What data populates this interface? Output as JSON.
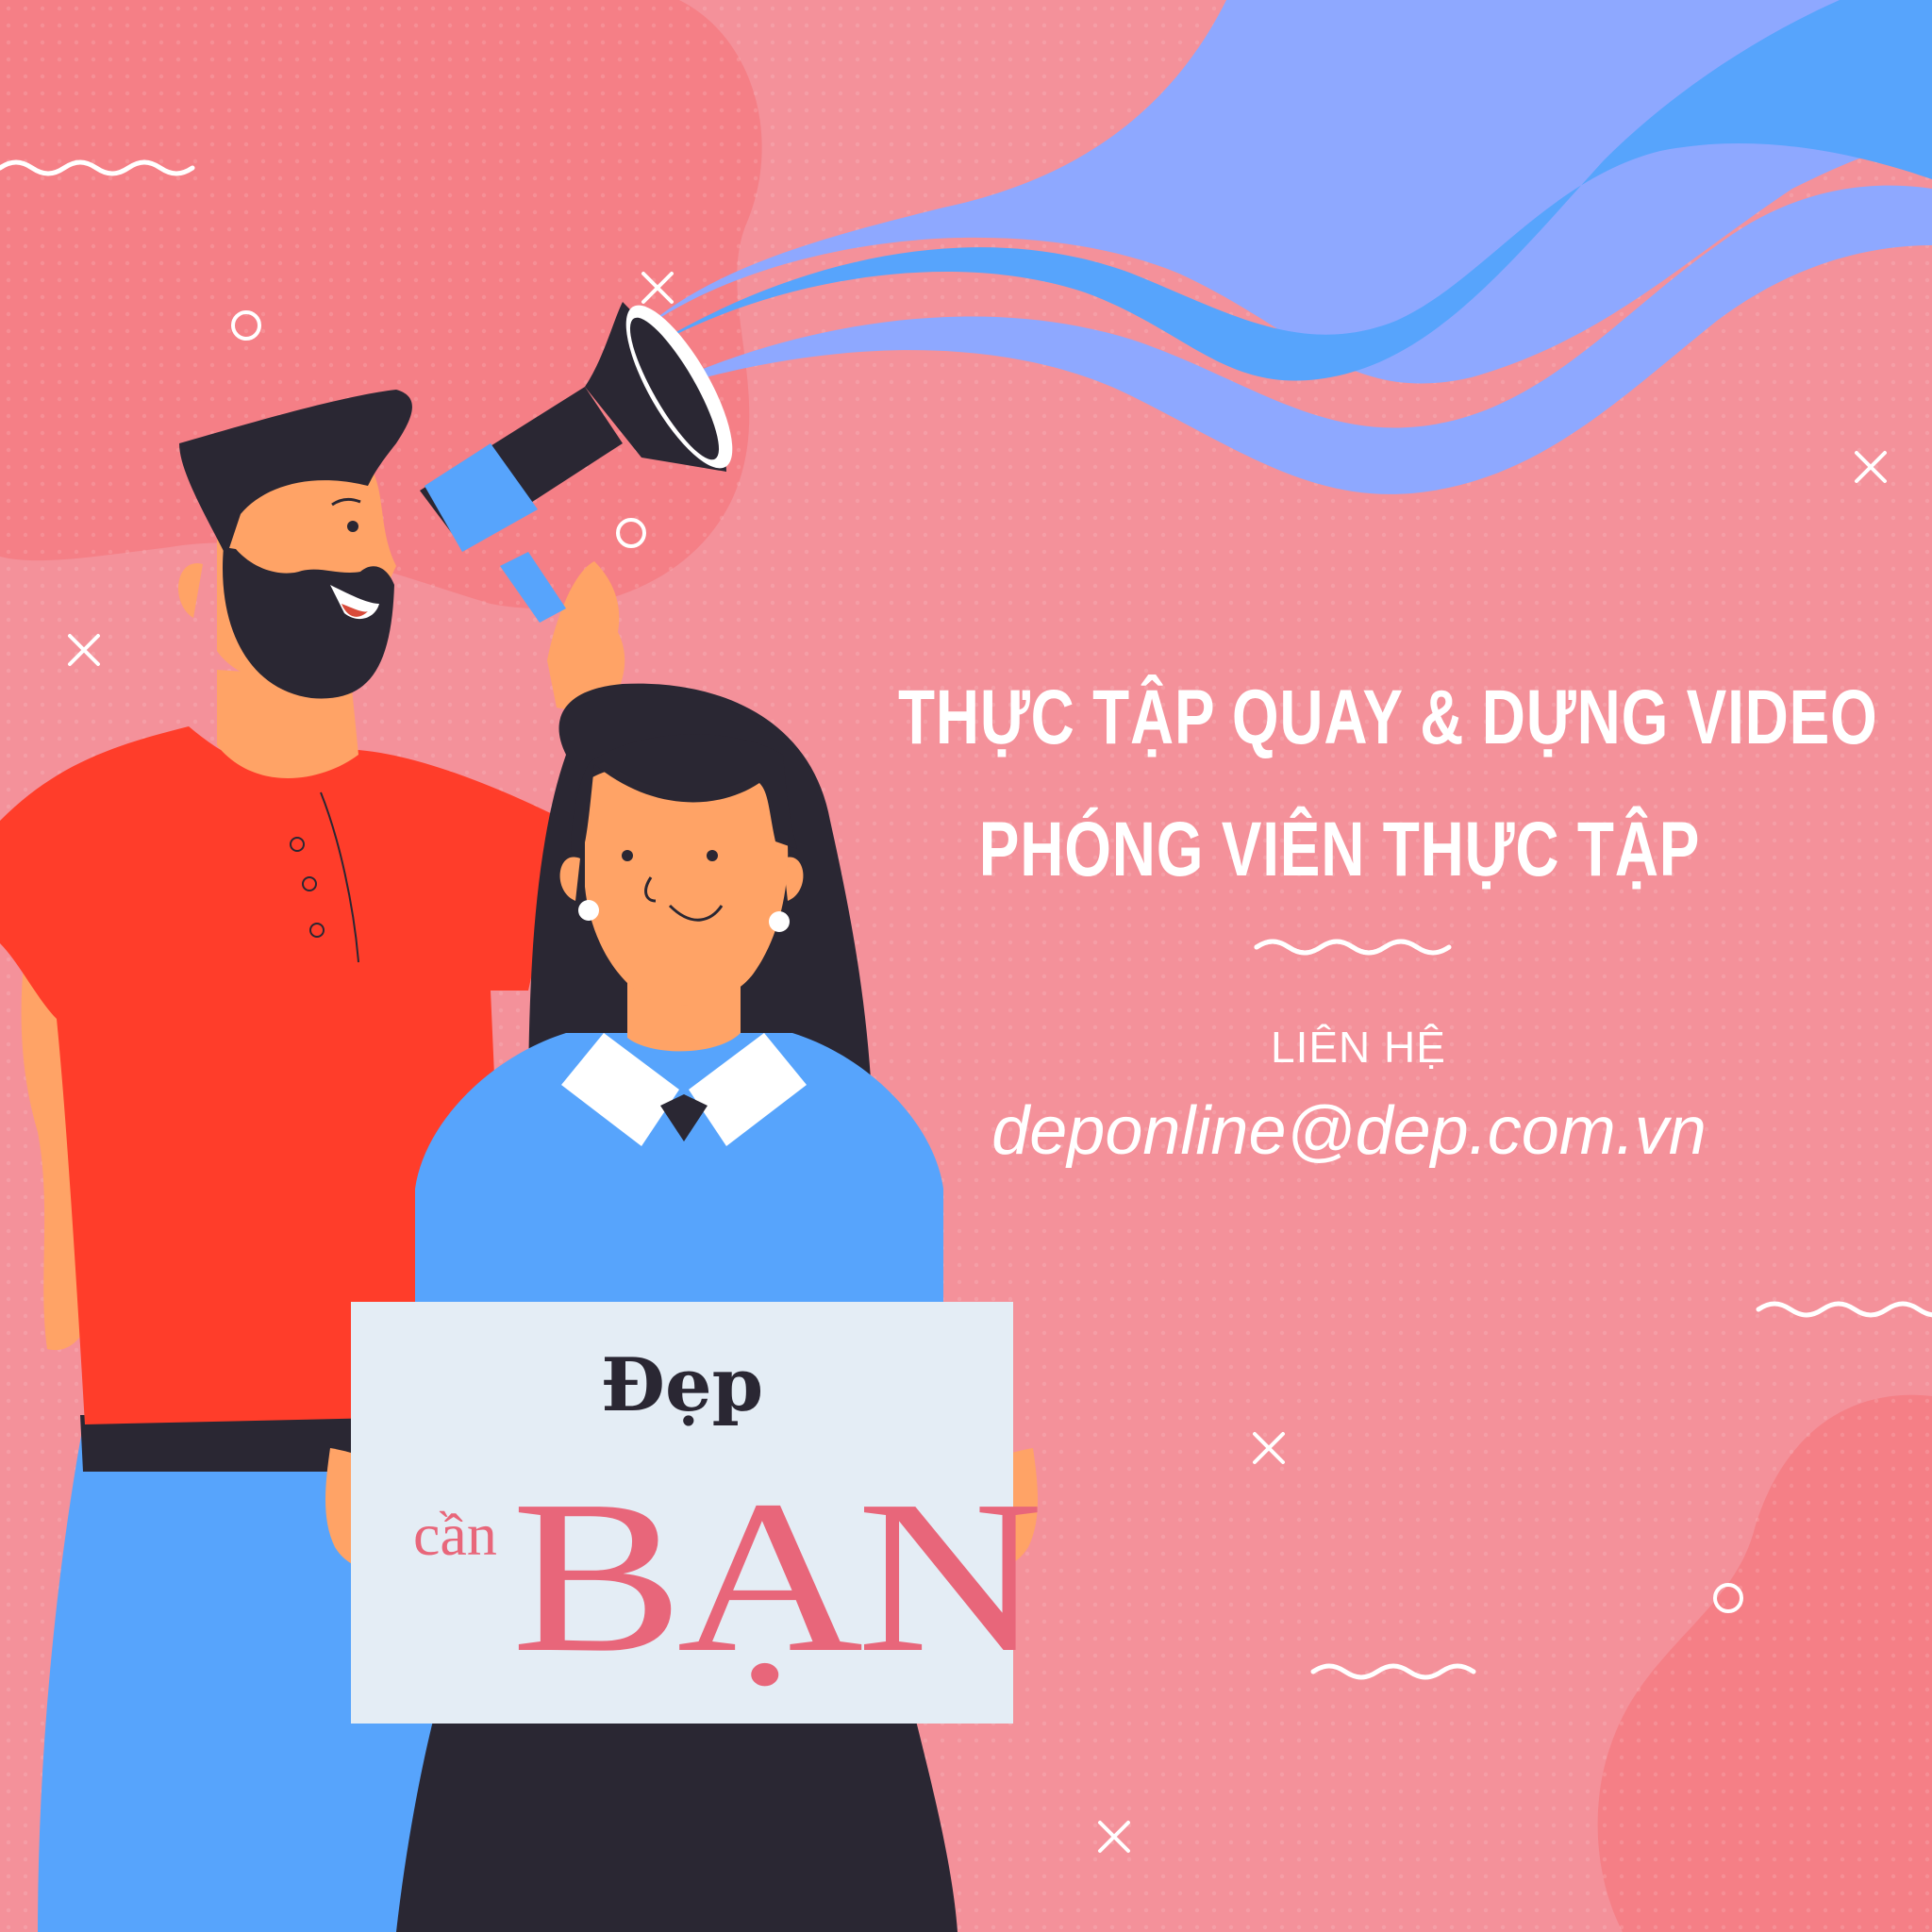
{
  "poster": {
    "headline_line1": "THỰC TẬP QUAY & DỰNG VIDEO",
    "headline_line2": "PHÓNG VIÊN THỰC TẬP",
    "contact_label": "LIÊN HỆ",
    "contact_email": "deponline@dep.com.vn"
  },
  "sign": {
    "logo": "Đẹp",
    "word_small": "cần",
    "word_big": "BẠN"
  },
  "colors": {
    "background": "#f4919a",
    "blob": "#f57f86",
    "wave_light": "#8ea8ff",
    "wave_dark": "#57a4fc",
    "shirt": "#ff3d2a",
    "skin": "#ffa366",
    "hair": "#2a2733",
    "sweater": "#57a4fc",
    "sign_bg": "#e4edf5",
    "sign_text": "#e8667a"
  },
  "icons": [
    "megaphone-icon",
    "cross-icon",
    "ring-icon",
    "squiggle-icon"
  ]
}
